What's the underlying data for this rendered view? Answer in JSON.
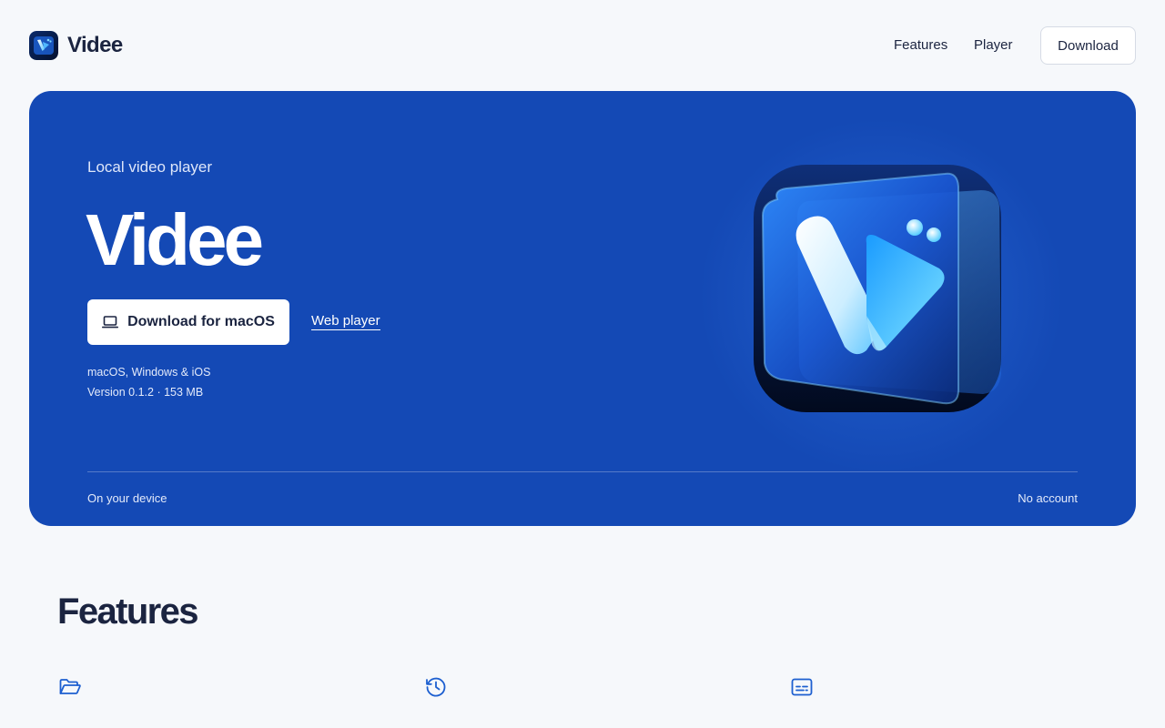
{
  "brand": {
    "name": "Videe",
    "accent": "#1449b5",
    "logo_icon": "videe-logo-icon"
  },
  "nav": {
    "features": "Features",
    "player": "Player",
    "download": "Download"
  },
  "hero": {
    "eyebrow": "Local video player",
    "title": "Videe",
    "download_button": "Download for macOS",
    "download_icon": "laptop-icon",
    "web_player_link": "Web player",
    "platforms": "macOS, Windows & iOS",
    "version": "Version 0.1.2 · 153 MB",
    "footnote_left": "On your device",
    "footnote_right": "No account",
    "app_icon": "videe-app-icon"
  },
  "features": {
    "title": "Features",
    "icons": [
      "folder-open-icon",
      "history-icon",
      "subtitles-icon"
    ]
  }
}
